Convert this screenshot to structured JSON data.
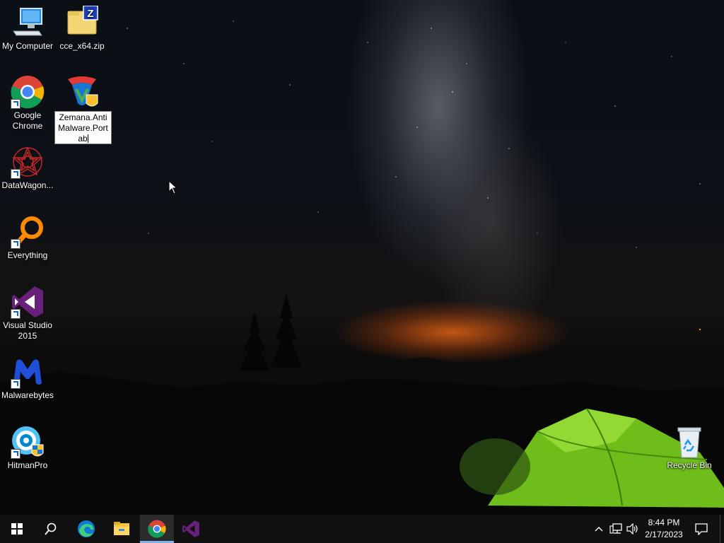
{
  "desktop": {
    "icons": [
      {
        "id": "my-computer",
        "label": "My Computer"
      },
      {
        "id": "cce-zip",
        "label": "cce_x64.zip"
      },
      {
        "id": "google-chrome",
        "label": "Google Chrome"
      },
      {
        "id": "zemana",
        "label": "Zemana.AntiMalware.Portab"
      },
      {
        "id": "datawagon",
        "label": "DataWagon..."
      },
      {
        "id": "everything",
        "label": "Everything"
      },
      {
        "id": "visual-studio",
        "label": "Visual Studio 2015"
      },
      {
        "id": "malwarebytes",
        "label": "Malwarebytes"
      },
      {
        "id": "hitmanpro",
        "label": "HitmanPro"
      },
      {
        "id": "recycle-bin",
        "label": "Recycle Bin"
      }
    ],
    "rename_lines": [
      "Zemana.Anti",
      "Malware.Port",
      "ab"
    ]
  },
  "taskbar": {
    "pinned": [
      "start-icon",
      "search-icon",
      "edge-icon",
      "file-explorer-icon",
      "chrome-icon",
      "visual-studio-icon"
    ],
    "active": "chrome-icon",
    "clock": {
      "time": "8:44 PM",
      "date": "2/17/2023"
    }
  }
}
